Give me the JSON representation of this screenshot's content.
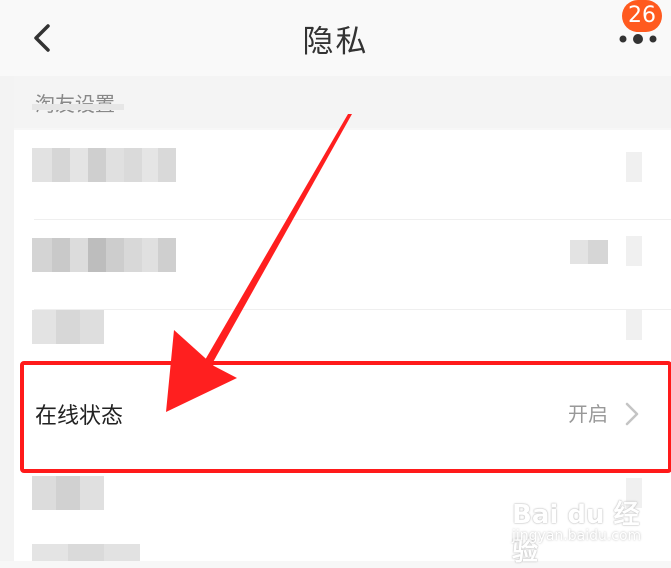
{
  "header": {
    "title": "隐私",
    "notification_count": "26"
  },
  "section": {
    "label": "淘友设置"
  },
  "online_status": {
    "label": "在线状态",
    "value": "开启"
  },
  "watermark": {
    "main": "Bai du 经验",
    "sub": "jingyan.baidu.com"
  },
  "colors": {
    "highlight": "#ff1a1a",
    "badge": "#ff5a1f"
  }
}
